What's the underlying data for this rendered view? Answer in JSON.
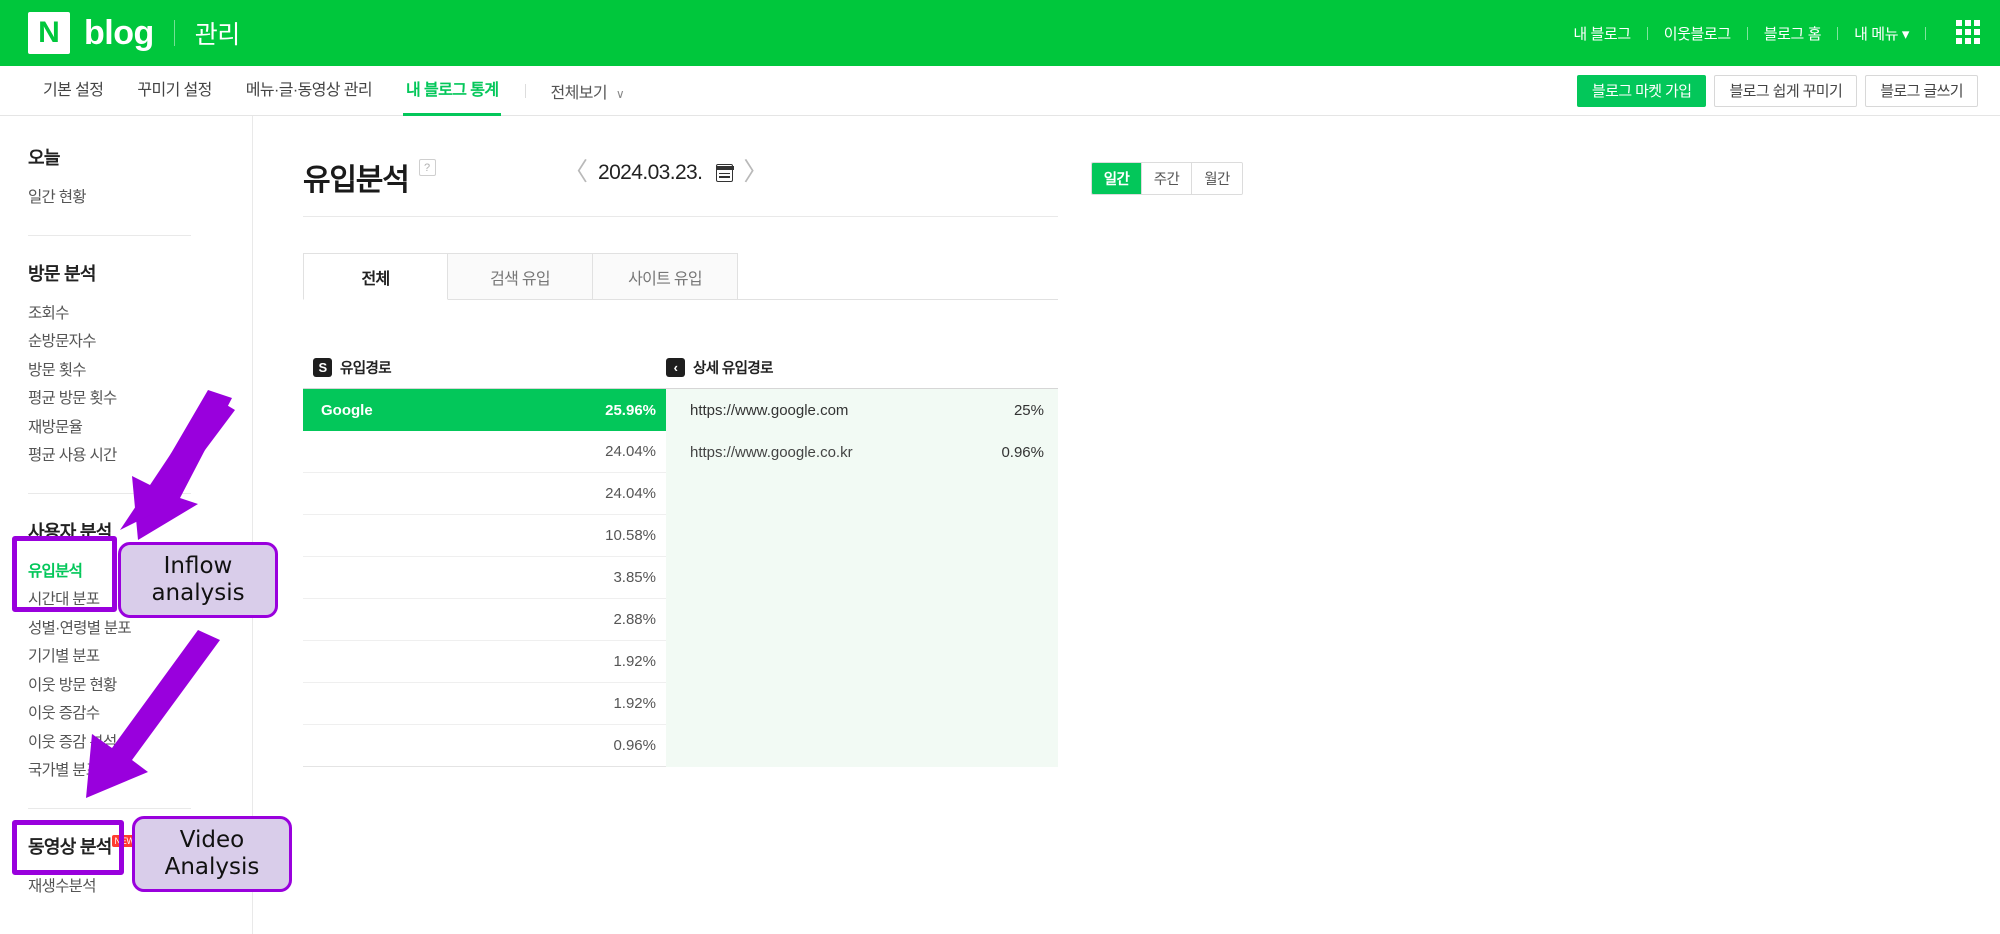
{
  "gnb": {
    "logo_mark": "N",
    "logo_word": "blog",
    "logo_sub": "관리",
    "links": [
      "내 블로그",
      "이웃블로그",
      "블로그 홈",
      "내 메뉴 ▾"
    ],
    "apps_icon": "apps-grid-icon"
  },
  "lnb": {
    "items": [
      {
        "label": "기본 설정",
        "active": false
      },
      {
        "label": "꾸미기 설정",
        "active": false
      },
      {
        "label": "메뉴·글·동영상 관리",
        "active": false
      },
      {
        "label": "내 블로그 통계",
        "active": true
      }
    ],
    "all_view": "전체보기",
    "all_view_chevron": "∨",
    "buttons": [
      {
        "label": "블로그 마켓 가입",
        "primary": true
      },
      {
        "label": "블로그 쉽게 꾸미기",
        "primary": false
      },
      {
        "label": "블로그 글쓰기",
        "primary": false
      }
    ]
  },
  "sidebar": {
    "groups": [
      {
        "head": "오늘",
        "items": [
          {
            "label": "일간 현황",
            "active": false
          }
        ]
      },
      {
        "head": "방문 분석",
        "items": [
          {
            "label": "조회수",
            "active": false
          },
          {
            "label": "순방문자수",
            "active": false
          },
          {
            "label": "방문 횟수",
            "active": false
          },
          {
            "label": "평균 방문 횟수",
            "active": false
          },
          {
            "label": "재방문율",
            "active": false
          },
          {
            "label": "평균 사용 시간",
            "active": false
          }
        ]
      },
      {
        "head": "사용자 분석",
        "items": [
          {
            "label": "유입분석",
            "active": true
          },
          {
            "label": "시간대 분포",
            "active": false
          },
          {
            "label": "성별·연령별 분포",
            "active": false
          },
          {
            "label": "기기별 분포",
            "active": false
          },
          {
            "label": "이웃 방문 현황",
            "active": false
          },
          {
            "label": "이웃 증감수",
            "active": false
          },
          {
            "label": "이웃 증감 분석",
            "active": false
          },
          {
            "label": "국가별 분포",
            "active": false
          }
        ]
      },
      {
        "head": "동영상 분석",
        "badge": "NEW",
        "items": [
          {
            "label": "재생수분석",
            "active": false
          }
        ]
      }
    ]
  },
  "main": {
    "title": "유입분석",
    "help_icon": "question-mark-icon",
    "date": {
      "prev": "〈",
      "value": "2024.03.23.",
      "next": "〉",
      "calendar_icon": "calendar-icon"
    },
    "period": [
      {
        "label": "일간",
        "active": true
      },
      {
        "label": "주간",
        "active": false
      },
      {
        "label": "월간",
        "active": false
      }
    ],
    "tabs": [
      {
        "label": "전체",
        "active": true
      },
      {
        "label": "검색 유입",
        "active": false
      },
      {
        "label": "사이트 유입",
        "active": false
      }
    ],
    "table": {
      "col1_icon": "S",
      "col1_header": "유입경로",
      "col2_icon": "‹",
      "col2_header": "상세 유입경로",
      "rows": [
        {
          "label": "Google",
          "pct": "25.96%",
          "top": true
        },
        {
          "label": "",
          "pct": "24.04%",
          "top": false
        },
        {
          "label": "",
          "pct": "24.04%",
          "top": false
        },
        {
          "label": "",
          "pct": "10.58%",
          "top": false
        },
        {
          "label": "",
          "pct": "3.85%",
          "top": false
        },
        {
          "label": "",
          "pct": "2.88%",
          "top": false
        },
        {
          "label": "",
          "pct": "1.92%",
          "top": false
        },
        {
          "label": "",
          "pct": "1.92%",
          "top": false
        },
        {
          "label": "",
          "pct": "0.96%",
          "top": false
        }
      ],
      "detail_rows": [
        {
          "url": "https://www.google.com",
          "pct": "25%"
        },
        {
          "url": "https://www.google.co.kr",
          "pct": "0.96%"
        }
      ]
    }
  },
  "annotations": [
    {
      "id": "inflow",
      "text": "Inflow\nanalysis",
      "line1": "Inflow",
      "line2": "analysis"
    },
    {
      "id": "video",
      "text": "Video\nAnalysis",
      "line1": "Video",
      "line2": "Analysis"
    }
  ],
  "colors": {
    "brand_green": "#03c75a",
    "gnb_green": "#00c73c",
    "annotation_purple": "#9900dd",
    "annotation_fill": "#d9cdea",
    "detail_panel": "#f2faf4"
  }
}
